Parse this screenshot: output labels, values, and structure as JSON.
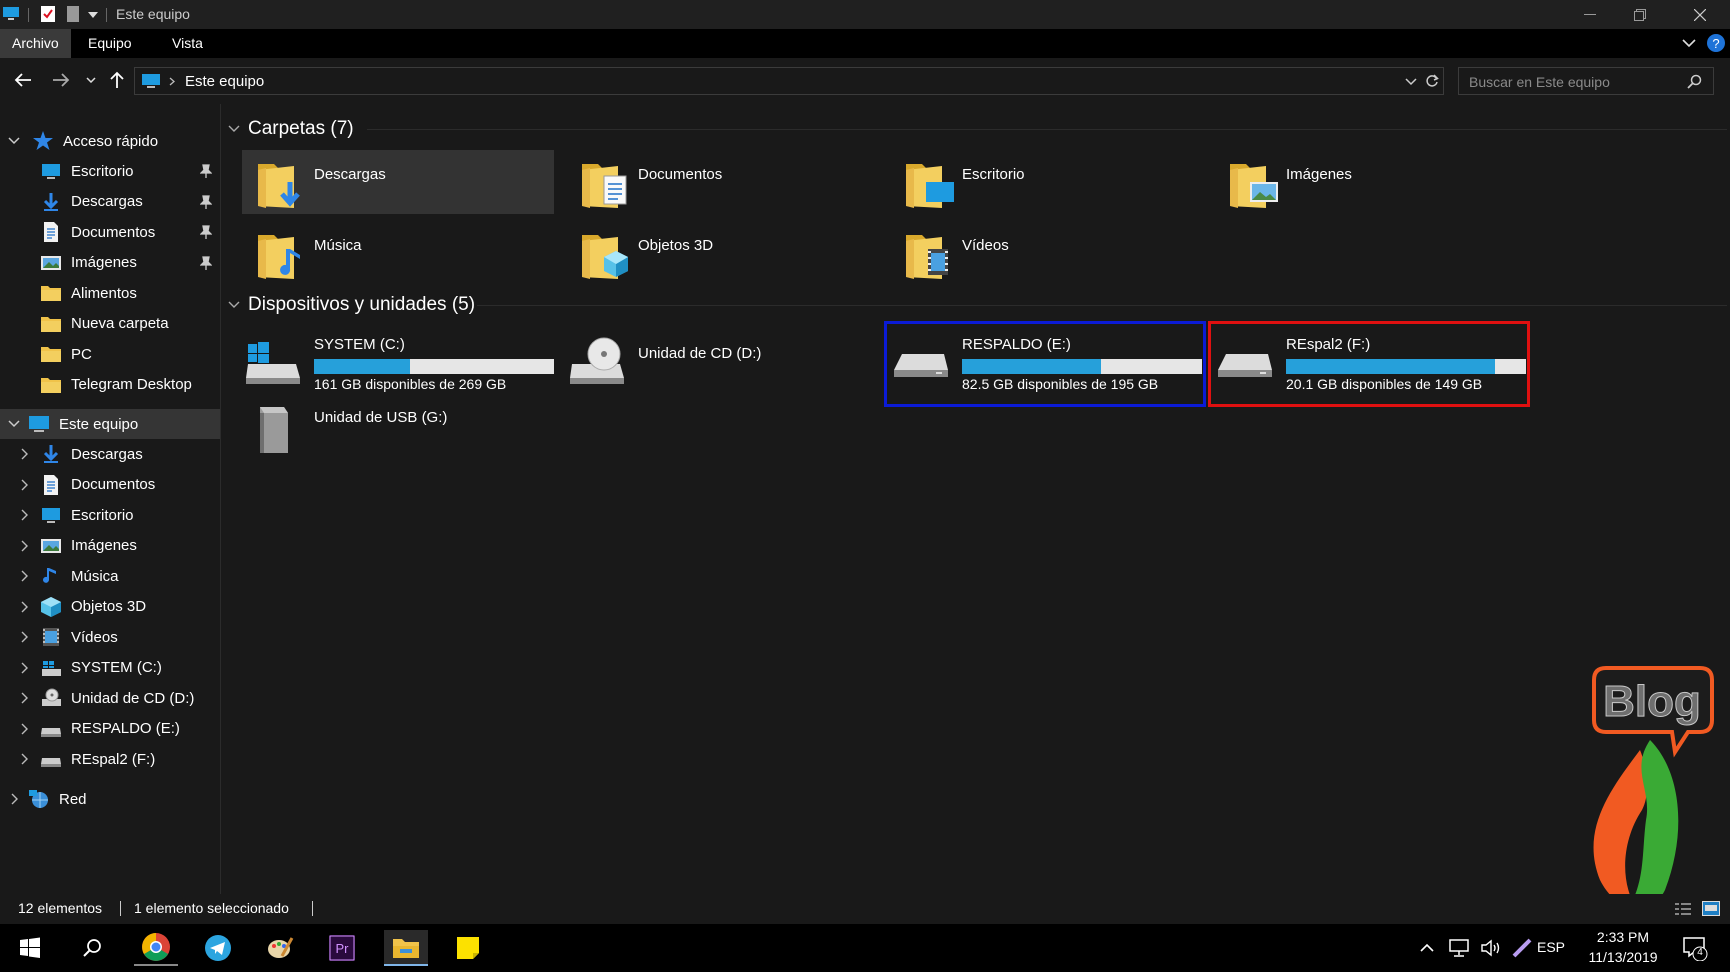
{
  "window": {
    "title": "Este equipo"
  },
  "ribbon": {
    "tabs": [
      {
        "label": "Archivo"
      },
      {
        "label": "Equipo"
      },
      {
        "label": "Vista"
      }
    ]
  },
  "address": {
    "path": "Este equipo",
    "search_placeholder": "Buscar en Este equipo"
  },
  "nav": {
    "quick_access": {
      "label": "Acceso rápido"
    },
    "quick_items": [
      {
        "label": "Escritorio",
        "icon": "desktop-icon",
        "pinned": true
      },
      {
        "label": "Descargas",
        "icon": "download-icon",
        "pinned": true
      },
      {
        "label": "Documentos",
        "icon": "document-icon",
        "pinned": true
      },
      {
        "label": "Imágenes",
        "icon": "image-icon",
        "pinned": true
      },
      {
        "label": "Alimentos",
        "icon": "folder-icon",
        "pinned": false
      },
      {
        "label": "Nueva carpeta",
        "icon": "folder-icon",
        "pinned": false
      },
      {
        "label": "PC",
        "icon": "folder-icon",
        "pinned": false
      },
      {
        "label": "Telegram Desktop",
        "icon": "folder-icon",
        "pinned": false
      }
    ],
    "this_pc": {
      "label": "Este equipo"
    },
    "pc_items": [
      {
        "label": "Descargas",
        "icon": "download-icon"
      },
      {
        "label": "Documentos",
        "icon": "document-icon"
      },
      {
        "label": "Escritorio",
        "icon": "desktop-icon"
      },
      {
        "label": "Imágenes",
        "icon": "image-icon"
      },
      {
        "label": "Música",
        "icon": "music-icon"
      },
      {
        "label": "Objetos 3D",
        "icon": "cube-icon"
      },
      {
        "label": "Vídeos",
        "icon": "video-icon"
      },
      {
        "label": "SYSTEM (C:)",
        "icon": "system-drive-icon"
      },
      {
        "label": "Unidad de CD (D:)",
        "icon": "cd-drive-icon"
      },
      {
        "label": "RESPALDO (E:)",
        "icon": "drive-icon"
      },
      {
        "label": "REspal2 (F:)",
        "icon": "drive-icon"
      }
    ],
    "network": {
      "label": "Red"
    }
  },
  "folders": {
    "header": "Carpetas (7)",
    "items": [
      {
        "label": "Descargas",
        "badge": "download-icon",
        "selected": true
      },
      {
        "label": "Documentos",
        "badge": "document-icon",
        "selected": false
      },
      {
        "label": "Escritorio",
        "badge": "desktop-icon",
        "selected": false
      },
      {
        "label": "Imágenes",
        "badge": "image-icon",
        "selected": false
      },
      {
        "label": "Música",
        "badge": "music-icon",
        "selected": false
      },
      {
        "label": "Objetos 3D",
        "badge": "cube-icon",
        "selected": false
      },
      {
        "label": "Vídeos",
        "badge": "video-icon",
        "selected": false
      }
    ]
  },
  "devices": {
    "header": "Dispositivos y unidades (5)",
    "items": [
      {
        "label": "SYSTEM (C:)",
        "free": "161 GB disponibles de 269 GB",
        "used_fraction": 0.4,
        "kind": "system",
        "highlight": ""
      },
      {
        "label": "Unidad de CD (D:)",
        "free": "",
        "used_fraction": null,
        "kind": "cd",
        "highlight": ""
      },
      {
        "label": "RESPALDO (E:)",
        "free": "82.5 GB disponibles de 195 GB",
        "used_fraction": 0.58,
        "kind": "hdd",
        "highlight": "#0b1bd6"
      },
      {
        "label": "REspal2 (F:)",
        "free": "20.1 GB disponibles de 149 GB",
        "used_fraction": 0.87,
        "kind": "hdd",
        "highlight": "#e01010"
      },
      {
        "label": "Unidad de USB (G:)",
        "free": "",
        "used_fraction": null,
        "kind": "usb",
        "highlight": ""
      }
    ]
  },
  "status": {
    "count": "12 elementos",
    "selected": "1 elemento seleccionado"
  },
  "taskbar": {
    "apps": [
      "windows-start-icon",
      "search-icon",
      "chrome-icon",
      "telegram-icon",
      "paint-icon",
      "premiere-icon",
      "file-explorer-icon",
      "sticky-notes-icon"
    ],
    "premiere_label": "Pr",
    "lang": "ESP",
    "time": "2:33 PM",
    "date": "11/13/2019",
    "notifications": "4"
  },
  "watermark": {
    "text": "Blog"
  },
  "colors": {
    "accent": "#26a0da",
    "bg": "#191919",
    "folder": "#f0c34a",
    "blue_highlight": "#0b1bd6",
    "red_highlight": "#e01010",
    "brand_orange": "#f15a22",
    "brand_green": "#3aaa35"
  }
}
